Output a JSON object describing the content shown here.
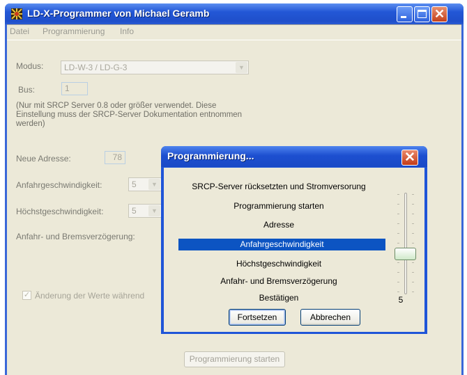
{
  "window": {
    "title": "LD-X-Programmer von Michael Geramb"
  },
  "menu": {
    "datei": "Datei",
    "programmierung": "Programmierung",
    "info": "Info"
  },
  "form": {
    "modus_label": "Modus:",
    "modus_value": "LD-W-3 / LD-G-3",
    "bus_label": "Bus:",
    "bus_value": "1",
    "note": "(Nur mit SRCP Server 0.8 oder größer verwendet. Diese Einstellung muss der SRCP-Server Dokumentation entnommen werden)",
    "neue_adresse_label": "Neue Adresse:",
    "neue_adresse_value": "78",
    "anfahr_label": "Anfahrgeschwindigkeit:",
    "anfahr_value": "5",
    "hoechst_label": "Höchstgeschwindigkeit:",
    "hoechst_value": "5",
    "brems_label": "Anfahr- und Bremsverzögerung:",
    "checkbox_label": "Änderung der Werte während",
    "start_button": "Programmierung starten"
  },
  "dialog": {
    "title": "Programmierung...",
    "steps": [
      "SRCP-Server rücksetzten und Stromversorung",
      "Programmierung starten",
      "Adresse",
      "Anfahrgeschwindigkeit",
      "Höchstgeschwindigkeit",
      "Anfahr- und Bremsverzögerung",
      "Bestätigen"
    ],
    "selected_step_index": 3,
    "slider_value": "5",
    "continue_button": "Fortsetzen",
    "cancel_button": "Abbrechen"
  },
  "colors": {
    "titlebar": "#2357d6",
    "selection": "#0c54c2",
    "close": "#c4411c"
  }
}
